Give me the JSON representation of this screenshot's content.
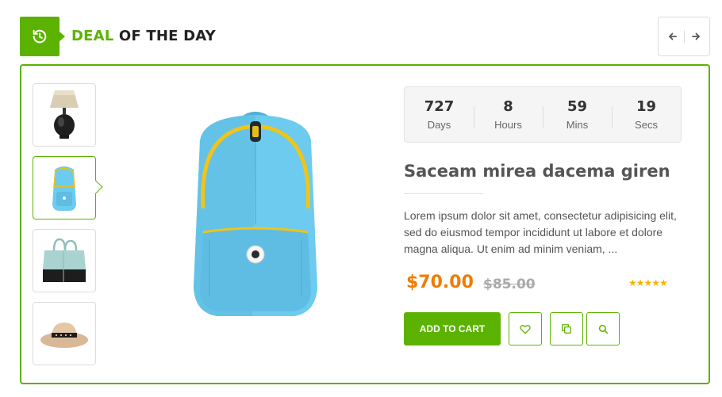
{
  "header": {
    "icon": "history-icon",
    "title_highlight": "DEAL",
    "title_rest": "OF THE DAY",
    "prev_icon": "arrow-left-icon",
    "next_icon": "arrow-right-icon"
  },
  "thumbnails": [
    {
      "name": "table-lamp",
      "active": false
    },
    {
      "name": "blue-backpack",
      "active": true
    },
    {
      "name": "tote-bag",
      "active": false
    },
    {
      "name": "straw-hat",
      "active": false
    }
  ],
  "countdown": [
    {
      "value": "727",
      "label": "Days"
    },
    {
      "value": "8",
      "label": "Hours"
    },
    {
      "value": "59",
      "label": "Mins"
    },
    {
      "value": "19",
      "label": "Secs"
    }
  ],
  "product": {
    "name": "Saceam mirea dacema giren",
    "description": "Lorem ipsum dolor sit amet, consectetur adipisicing elit, sed do eiusmod tempor incididunt ut labore et dolore magna aliqua. Ut enim ad minim veniam, ...",
    "price": "$70.00",
    "old_price": "$85.00",
    "rating_stars": 5,
    "rating_text": "★★★★★"
  },
  "actions": {
    "add_to_cart": "ADD TO CART",
    "wishlist_icon": "heart-icon",
    "compare_icon": "copy-icon",
    "quickview_icon": "search-icon"
  },
  "colors": {
    "accent": "#5cb200",
    "price": "#f07c00",
    "stars": "#f3b400"
  }
}
